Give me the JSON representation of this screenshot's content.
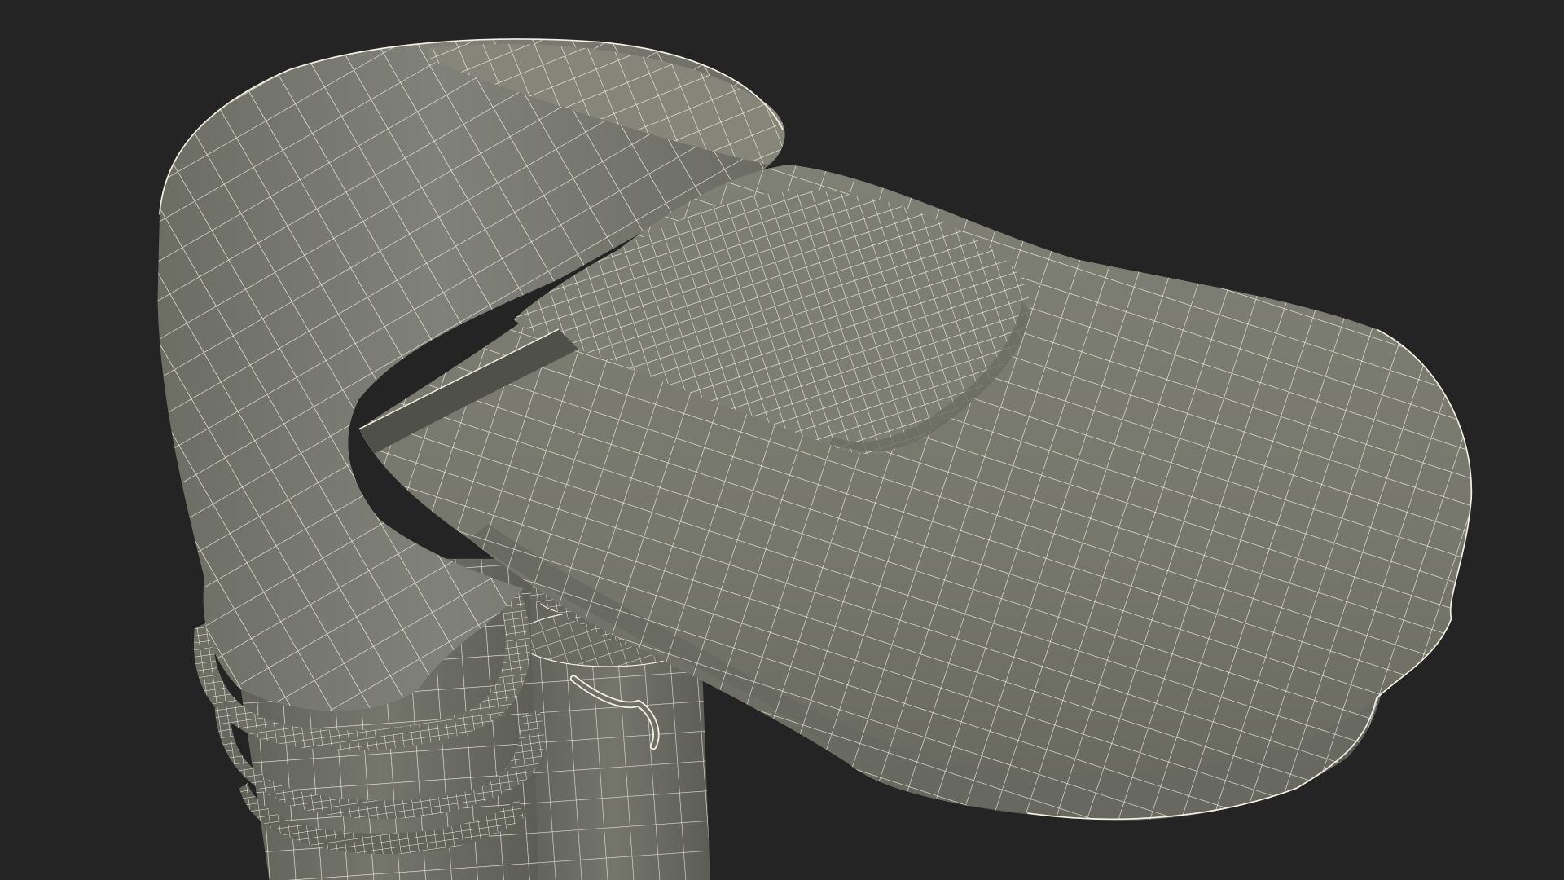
{
  "scene": {
    "background_color": "#242424",
    "surface_color": "#7a7b70",
    "surface_shadow_color": "#5e5f56",
    "surface_highlight_color": "#8b8c80",
    "wire_color": "#f2f0e0"
  }
}
